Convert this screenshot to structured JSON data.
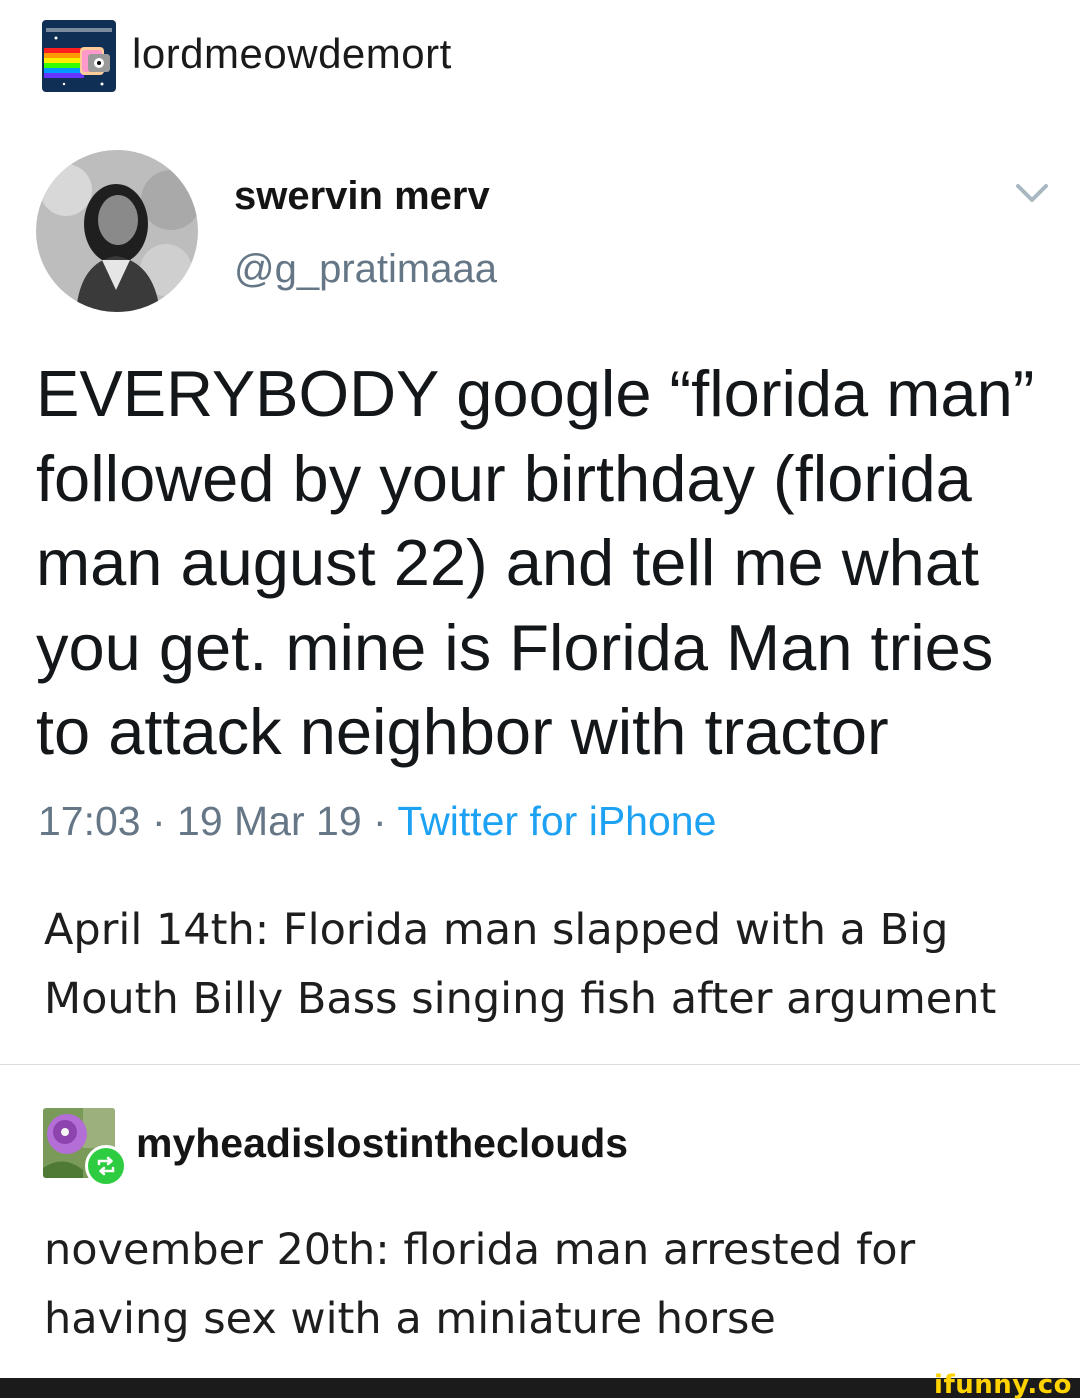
{
  "post": {
    "blog_name": "lordmeowdemort",
    "avatar_icon": "nyan-cat-avatar"
  },
  "tweet": {
    "display_name": "swervin merv",
    "handle": "@g_pratimaaa",
    "text": "EVERYBODY google “florida man” followed by your birthday (florida man august 22) and tell me what you get. mine is Florida Man tries to attack neighbor with tractor",
    "time": "17:03 · 19 Mar 19 · ",
    "source": "Twitter for iPhone",
    "menu_icon": "chevron-down-icon"
  },
  "reply1": {
    "text": "April 14th: Florida man slapped with a Big Mouth Billy Bass singing fish after argument"
  },
  "reblog": {
    "blog_name": "myheadislostintheclouds",
    "avatar_icon": "flower-avatar",
    "badge_icon": "reblog-icon",
    "text": "november 20th: florida man arrested for having sex with a miniature horse"
  },
  "watermark": "ifunny.co",
  "colors": {
    "link_blue": "#1da1f2",
    "muted_gray": "#657786",
    "reblog_green": "#2ecc40",
    "watermark_yellow": "#ffd200"
  }
}
